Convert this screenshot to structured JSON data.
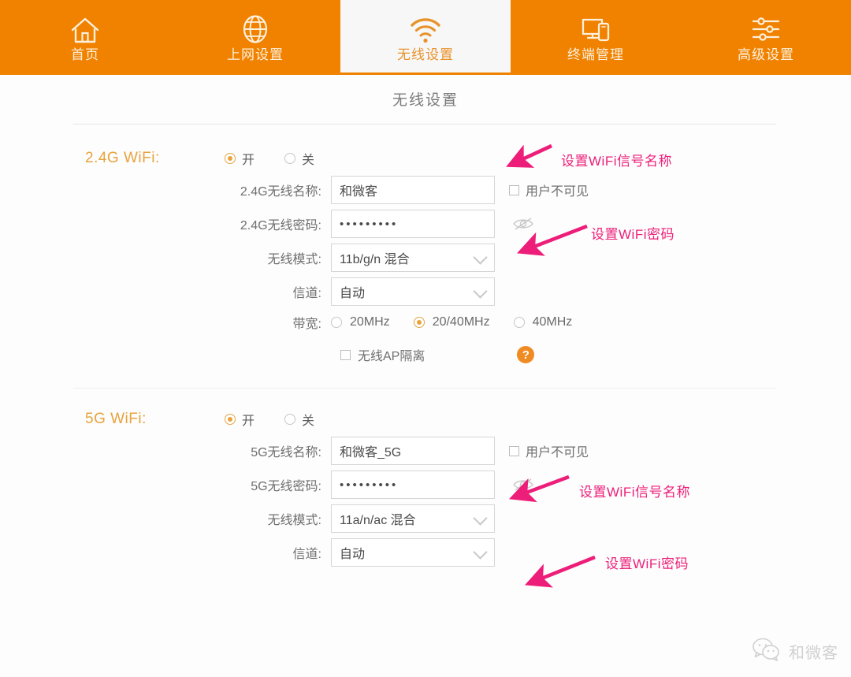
{
  "nav": {
    "items": [
      {
        "label": "首页",
        "icon": "home-icon",
        "active": false
      },
      {
        "label": "上网设置",
        "icon": "globe-icon",
        "active": false
      },
      {
        "label": "无线设置",
        "icon": "wifi-icon",
        "active": true
      },
      {
        "label": "终端管理",
        "icon": "devices-icon",
        "active": false
      },
      {
        "label": "高级设置",
        "icon": "sliders-icon",
        "active": false
      }
    ],
    "accent_color": "#f08200",
    "active_bg": "#f7f7f7"
  },
  "page": {
    "title": "无线设置"
  },
  "band24": {
    "title": "2.4G WiFi:",
    "power_on_label": "开",
    "power_off_label": "关",
    "power_value": "开",
    "ssid_label": "2.4G无线名称:",
    "ssid_value": "和微客",
    "hidden_checkbox_label": "用户不可见",
    "hidden_checkbox_checked": false,
    "password_label": "2.4G无线密码:",
    "password_value": "•••••••••",
    "eye_icon": "eye-off-icon",
    "mode_label": "无线模式:",
    "mode_value": "11b/g/n 混合",
    "channel_label": "信道:",
    "channel_value": "自动",
    "bandwidth_label": "带宽:",
    "bandwidth_options": [
      "20MHz",
      "20/40MHz",
      "40MHz"
    ],
    "bandwidth_value": "20/40MHz",
    "ap_isolation_label": "无线AP隔离",
    "ap_isolation_checked": false,
    "help_icon_label": "?"
  },
  "band5": {
    "title": "5G WiFi:",
    "power_on_label": "开",
    "power_off_label": "关",
    "power_value": "开",
    "ssid_label": "5G无线名称:",
    "ssid_value": "和微客_5G",
    "hidden_checkbox_label": "用户不可见",
    "hidden_checkbox_checked": false,
    "password_label": "5G无线密码:",
    "password_value": "•••••••••",
    "eye_icon": "eye-off-icon",
    "mode_label": "无线模式:",
    "mode_value": "11a/n/ac 混合",
    "channel_label": "信道:",
    "channel_value": "自动"
  },
  "annotations": {
    "color": "#ed1e79",
    "items": [
      {
        "text": "设置WiFi信号名称",
        "target": "band24-ssid"
      },
      {
        "text": "设置WiFi密码",
        "target": "band24-password"
      },
      {
        "text": "设置WiFi信号名称",
        "target": "band5-ssid"
      },
      {
        "text": "设置WiFi密码",
        "target": "band5-password"
      }
    ]
  },
  "watermark": {
    "text": "和微客",
    "icon": "wechat-bubbles-icon"
  }
}
